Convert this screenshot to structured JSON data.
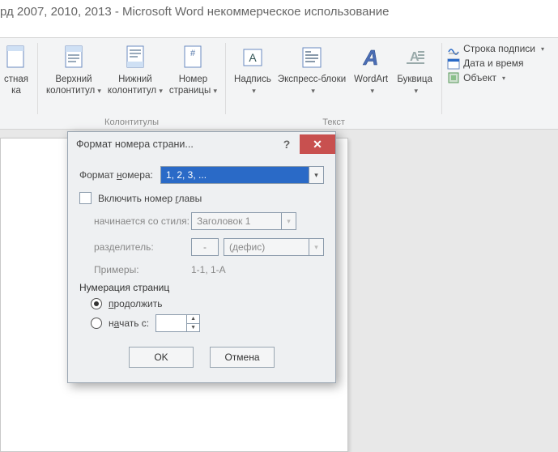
{
  "window": {
    "title": "рд 2007, 2010, 2013  -  Microsoft Word некоммерческое использование"
  },
  "ribbon": {
    "partial_btn": {
      "line1": "стная",
      "line2": "ка"
    },
    "header_top": {
      "label": "Верхний",
      "label2": "колонтитул"
    },
    "footer_bot": {
      "label": "Нижний",
      "label2": "колонтитул"
    },
    "page_num": {
      "label": "Номер",
      "label2": "страницы"
    },
    "group_hf": "Колонтитулы",
    "textbox": {
      "label": "Надпись"
    },
    "quick": {
      "label": "Экспресс-блоки"
    },
    "wordart": {
      "label": "WordArt"
    },
    "dropcap": {
      "label": "Буквица"
    },
    "group_text": "Текст",
    "sigline": "Строка подписи",
    "datetime": "Дата и время",
    "object": "Объект"
  },
  "dialog": {
    "title": "Формат номера страни...",
    "format_label": "Формат номера:",
    "format_value": "1, 2, 3, ...",
    "include_chapter": "Включить номер главы",
    "starts_with_style": "начинается со стиля:",
    "style_value": "Заголовок 1",
    "separator_label": "разделитель:",
    "separator_sym": "-",
    "separator_text": "(дефис)",
    "examples_label": "Примеры:",
    "examples_value": "1-1, 1-A",
    "numbering_title": "Нумерация страниц",
    "continue": "продолжить",
    "start_at": "начать с:",
    "start_value": "",
    "ok": "OK",
    "cancel": "Отмена"
  }
}
